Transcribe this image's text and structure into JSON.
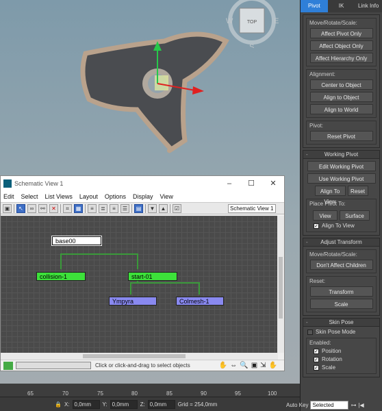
{
  "viewport": {
    "cube_label": "TOP",
    "compass": [
      "W",
      "E",
      "S"
    ]
  },
  "cmd": {
    "tabs": [
      "Pivot",
      "IK",
      "Link Info"
    ],
    "adjust_pivot": {
      "group1": {
        "label": "Move/Rotate/Scale:",
        "buttons": [
          "Affect Pivot Only",
          "Affect Object Only",
          "Affect Hierarchy Only"
        ]
      },
      "group2": {
        "label": "Alignment:",
        "buttons": [
          "Center to Object",
          "Align to Object",
          "Align to World"
        ]
      },
      "group3": {
        "label": "Pivot:",
        "buttons": [
          "Reset Pivot"
        ]
      }
    },
    "working_pivot": {
      "title": "Working Pivot",
      "buttons": [
        "Edit Working Pivot",
        "Use Working Pivot"
      ],
      "row": [
        "Align To View",
        "Reset"
      ],
      "place_label": "Place Pivot To:",
      "place": [
        "View",
        "Surface"
      ],
      "align_to_view": "Align To View"
    },
    "adjust_transform": {
      "title": "Adjust Transform",
      "label": "Move/Rotate/Scale:",
      "button": "Don't Affect Children",
      "reset_label": "Reset:",
      "reset_buttons": [
        "Transform",
        "Scale"
      ]
    },
    "skin_pose": {
      "title": "Skin Pose",
      "mode": "Skin Pose Mode",
      "enabled_label": "Enabled:",
      "checks": [
        "Position",
        "Rotation",
        "Scale"
      ]
    }
  },
  "schematic": {
    "title": "Schematic View 1",
    "menu": [
      "Edit",
      "Select",
      "List Views",
      "Layout",
      "Options",
      "Display",
      "View"
    ],
    "view_select": "Schematic View 1",
    "nodes": {
      "base": "base00",
      "collision": "collision-1",
      "start": "start-01",
      "ympyra": "Ympyra",
      "colmesh": "Colmesh-1"
    },
    "status": "Click or click-and-drag to select objects"
  },
  "bottom": {
    "ruler": [
      "65",
      "70",
      "75",
      "80",
      "85",
      "90",
      "95",
      "100"
    ],
    "x_label": "X:",
    "x": "0,0mm",
    "y_label": "Y:",
    "y": "0,0mm",
    "z_label": "Z:",
    "z": "0,0mm",
    "grid": "Grid = 254,0mm",
    "auto_key": "Auto Key",
    "selected": "Selected"
  }
}
